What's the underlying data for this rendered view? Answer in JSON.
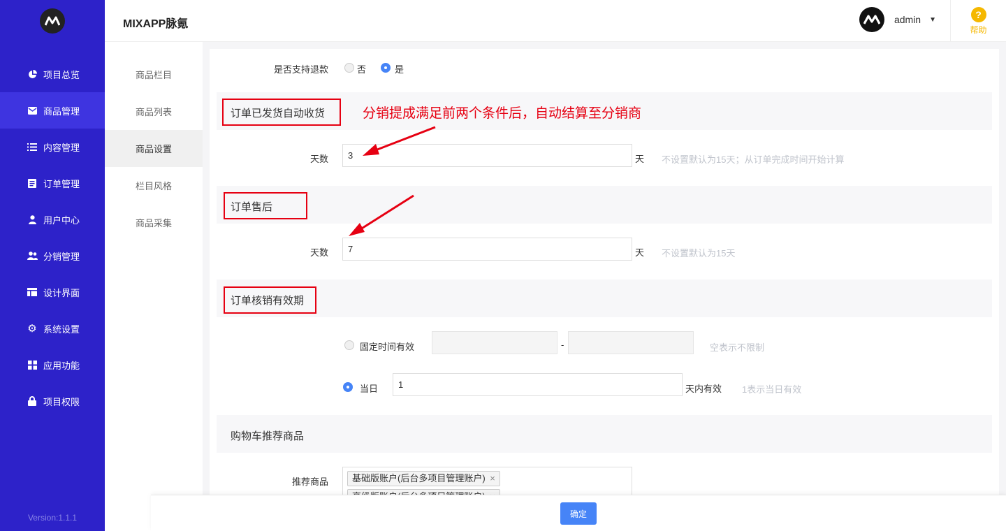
{
  "app": {
    "brand": "MIXAPP脉氪",
    "version": "Version:1.1.1"
  },
  "header": {
    "user": "admin",
    "help": "帮助"
  },
  "nav": [
    {
      "label": "项目总览",
      "icon": "pie-chart-icon"
    },
    {
      "label": "商品管理",
      "icon": "envelope-icon",
      "active": true
    },
    {
      "label": "内容管理",
      "icon": "list-icon"
    },
    {
      "label": "订单管理",
      "icon": "document-icon"
    },
    {
      "label": "用户中心",
      "icon": "user-icon"
    },
    {
      "label": "分销管理",
      "icon": "users-icon"
    },
    {
      "label": "设计界面",
      "icon": "layout-icon"
    },
    {
      "label": "系统设置",
      "icon": "gear-icon"
    },
    {
      "label": "应用功能",
      "icon": "grid-icon"
    },
    {
      "label": "项目权限",
      "icon": "lock-icon"
    }
  ],
  "submenu": [
    "商品栏目",
    "商品列表",
    "商品设置",
    "栏目风格",
    "商品采集"
  ],
  "refund": {
    "label": "是否支持退款",
    "opt_no": "否",
    "opt_yes": "是",
    "selected": "是"
  },
  "auto_receive": {
    "title": "订单已发货自动收货",
    "annotation": "分销提成满足前两个条件后，自动结算至分销商",
    "label": "天数",
    "value": "3",
    "unit": "天",
    "hint": "不设置默认为15天；从订单完成时间开始计算"
  },
  "after_sale": {
    "title": "订单售后",
    "label": "天数",
    "value": "7",
    "unit": "天",
    "hint": "不设置默认为15天"
  },
  "verify": {
    "title": "订单核销有效期",
    "fixed_label": "固定时间有效",
    "sep": "-",
    "fixed_hint": "空表示不限制",
    "day_label": "当日",
    "day_value": "1",
    "day_suffix": "天内有效",
    "day_hint": "1表示当日有效",
    "selected": "当日"
  },
  "cart": {
    "title": "购物车推荐商品",
    "label": "推荐商品",
    "tags": [
      "基础版账户(后台多项目管理账户)",
      "高级版账户(后台多项目管理账户)"
    ],
    "tag_remove": "×"
  },
  "footer": {
    "confirm": "确定"
  }
}
